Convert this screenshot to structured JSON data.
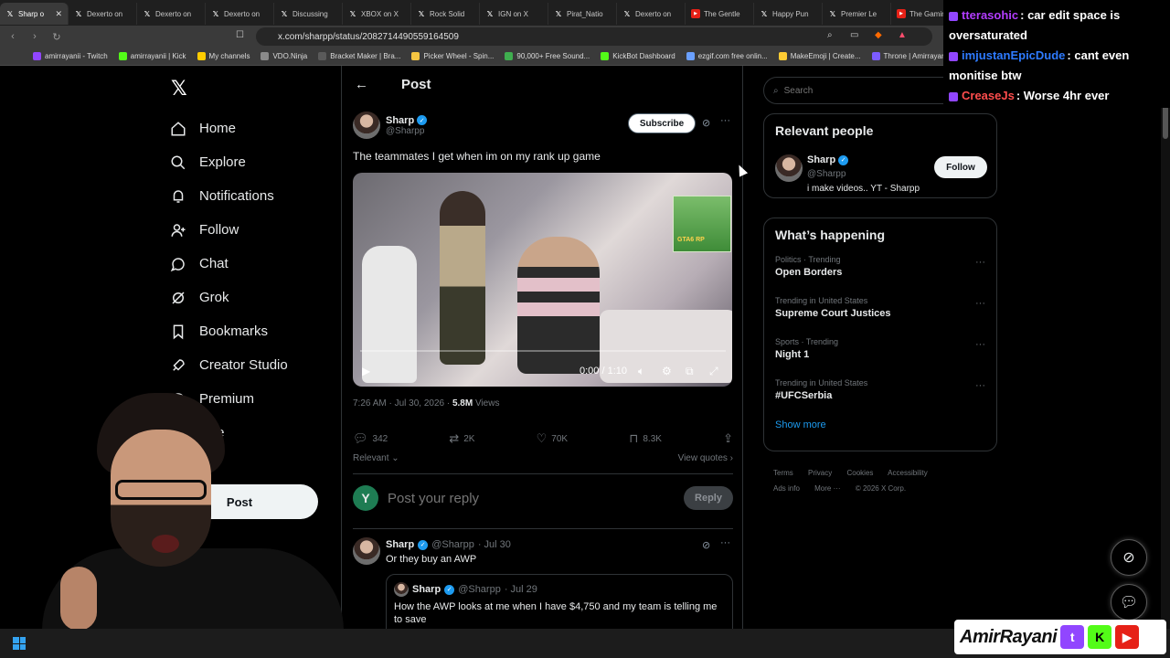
{
  "browser": {
    "tabs": [
      {
        "label": "Sharp o",
        "icon": "x-icon",
        "active": true
      },
      {
        "label": "Dexerto on",
        "icon": "x-icon"
      },
      {
        "label": "Dexerto on",
        "icon": "x-icon"
      },
      {
        "label": "Dexerto on",
        "icon": "x-icon"
      },
      {
        "label": "Discussing",
        "icon": "x-icon"
      },
      {
        "label": "XBOX on X",
        "icon": "x-icon"
      },
      {
        "label": "Rock Solid",
        "icon": "x-icon"
      },
      {
        "label": "IGN on X",
        "icon": "x-icon"
      },
      {
        "label": "Pirat_Natio",
        "icon": "x-icon"
      },
      {
        "label": "Dexerto on",
        "icon": "x-icon"
      },
      {
        "label": "The Gentle",
        "icon": "youtube-icon"
      },
      {
        "label": "Happy Pun",
        "icon": "x-icon"
      },
      {
        "label": "Premier Le",
        "icon": "x-icon"
      },
      {
        "label": "The Gaming",
        "icon": "youtube-icon"
      }
    ],
    "url": "x.com/sharpp/status/2082714490559164509",
    "bookmarks": [
      {
        "label": "amirrayanii - Twitch",
        "color": "#9146ff"
      },
      {
        "label": "amirrayanii | Kick",
        "color": "#53fc18"
      },
      {
        "label": "My channels",
        "color": "#ffcc00"
      },
      {
        "label": "VDO.Ninja",
        "color": "#8a8a8a"
      },
      {
        "label": "Bracket Maker | Bra...",
        "color": "#5a5a5a"
      },
      {
        "label": "Picker Wheel - Spin...",
        "color": "#f5c542"
      },
      {
        "label": "90,000+ Free Sound...",
        "color": "#3fae4f"
      },
      {
        "label": "KickBot Dashboard",
        "color": "#53fc18"
      },
      {
        "label": "ezgif.com free onlin...",
        "color": "#6aa0ff"
      },
      {
        "label": "MakeEmoji | Create...",
        "color": "#ffcc33"
      },
      {
        "label": "Throne | Amirrayan",
        "color": "#7c5cff"
      }
    ]
  },
  "chat": [
    {
      "user": "tterasohic",
      "user_color": "#b33dff",
      "message": ": car edit space is oversaturated"
    },
    {
      "user": "imjustanEpicDude",
      "user_color": "#2e7bff",
      "message": ": cant even monitise btw"
    },
    {
      "user": "CreaseJs",
      "user_color": "#ff4d4d",
      "message": ": Worse 4hr ever"
    }
  ],
  "sidebar": {
    "items": [
      {
        "label": "Home",
        "icon": "home-icon"
      },
      {
        "label": "Explore",
        "icon": "search-icon"
      },
      {
        "label": "Notifications",
        "icon": "bell-icon"
      },
      {
        "label": "Follow",
        "icon": "follow-icon"
      },
      {
        "label": "Chat",
        "icon": "chat-icon"
      },
      {
        "label": "Grok",
        "icon": "grok-icon"
      },
      {
        "label": "Bookmarks",
        "icon": "bookmark-icon"
      },
      {
        "label": "Creator Studio",
        "icon": "rocket-icon"
      },
      {
        "label": "Premium",
        "icon": "premium-icon"
      },
      {
        "label": "ofile",
        "icon": "profile-icon"
      },
      {
        "label": "re",
        "icon": "more-icon"
      }
    ],
    "post_button": "Post"
  },
  "post": {
    "header_title": "Post",
    "author_name": "Sharp",
    "author_handle": "@Sharpp",
    "subscribe_label": "Subscribe",
    "text": "The teammates I get when im on my rank up game",
    "video": {
      "time": "0:00 / 1:10",
      "overlay_text": "GTA6 RP",
      "progress_fraction": 0.0
    },
    "timestamp": "7:26 AM · Jul 30, 2026 · ",
    "views": "5.8M",
    "views_label": " Views",
    "replies": "342",
    "reposts": "2K",
    "likes": "70K",
    "bookmarks": "8.3K",
    "sort_label": "Relevant",
    "view_quotes": "View quotes",
    "reply_avatar_letter": "Y",
    "reply_placeholder": "Post your reply",
    "reply_button": "Reply"
  },
  "reply": {
    "author_name": "Sharp",
    "author_handle": "@Sharpp",
    "date": "· Jul 30",
    "text": "Or they buy an AWP",
    "quote": {
      "author_name": "Sharp",
      "author_handle": "@Sharpp",
      "date": "· Jul 29",
      "text": "How the AWP looks at me when I have $4,750 and my team is telling me to save"
    }
  },
  "right": {
    "search_placeholder": "Search",
    "relevant_title": "Relevant people",
    "person": {
      "name": "Sharp",
      "handle": "@Sharpp",
      "bio": "i make videos.. YT - Sharpp",
      "follow_label": "Follow"
    },
    "happening_title": "What’s happening",
    "trends": [
      {
        "context": "Politics · Trending",
        "name": "Open Borders"
      },
      {
        "context": "Trending in United States",
        "name": "Supreme Court Justices"
      },
      {
        "context": "Sports · Trending",
        "name": "Night 1"
      },
      {
        "context": "Trending in United States",
        "name": "#UFCSerbia"
      }
    ],
    "show_more": "Show more",
    "footer": [
      "Terms",
      "Privacy",
      "Cookies",
      "Accessibility",
      "Ads info",
      "More ···",
      "© 2026 X Corp."
    ]
  },
  "brand": {
    "name": "AmirRayani"
  }
}
